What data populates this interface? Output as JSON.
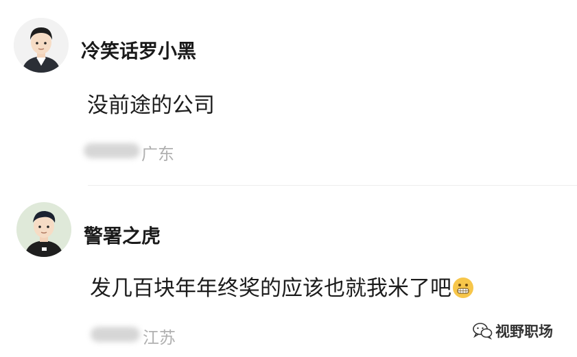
{
  "comments": [
    {
      "username": "冷笑话罗小黑",
      "text": "没前途的公司",
      "location": "广东",
      "avatar_icon": "cartoon-man-dark-hoodie-avatar"
    },
    {
      "username": "警署之虎",
      "text": "发几百块年年终奖的应该也就我米了吧",
      "location": "江苏",
      "avatar_icon": "cartoon-man-black-shirt-avatar",
      "emoji": "grinning-teeth-emoji"
    }
  ],
  "watermark": {
    "label": "视野职场",
    "icon": "wechat-logo-icon"
  },
  "colors": {
    "username": "#1a1a1a",
    "text": "#1c1c1c",
    "location": "#b0b0b0",
    "divider": "#ececec"
  }
}
